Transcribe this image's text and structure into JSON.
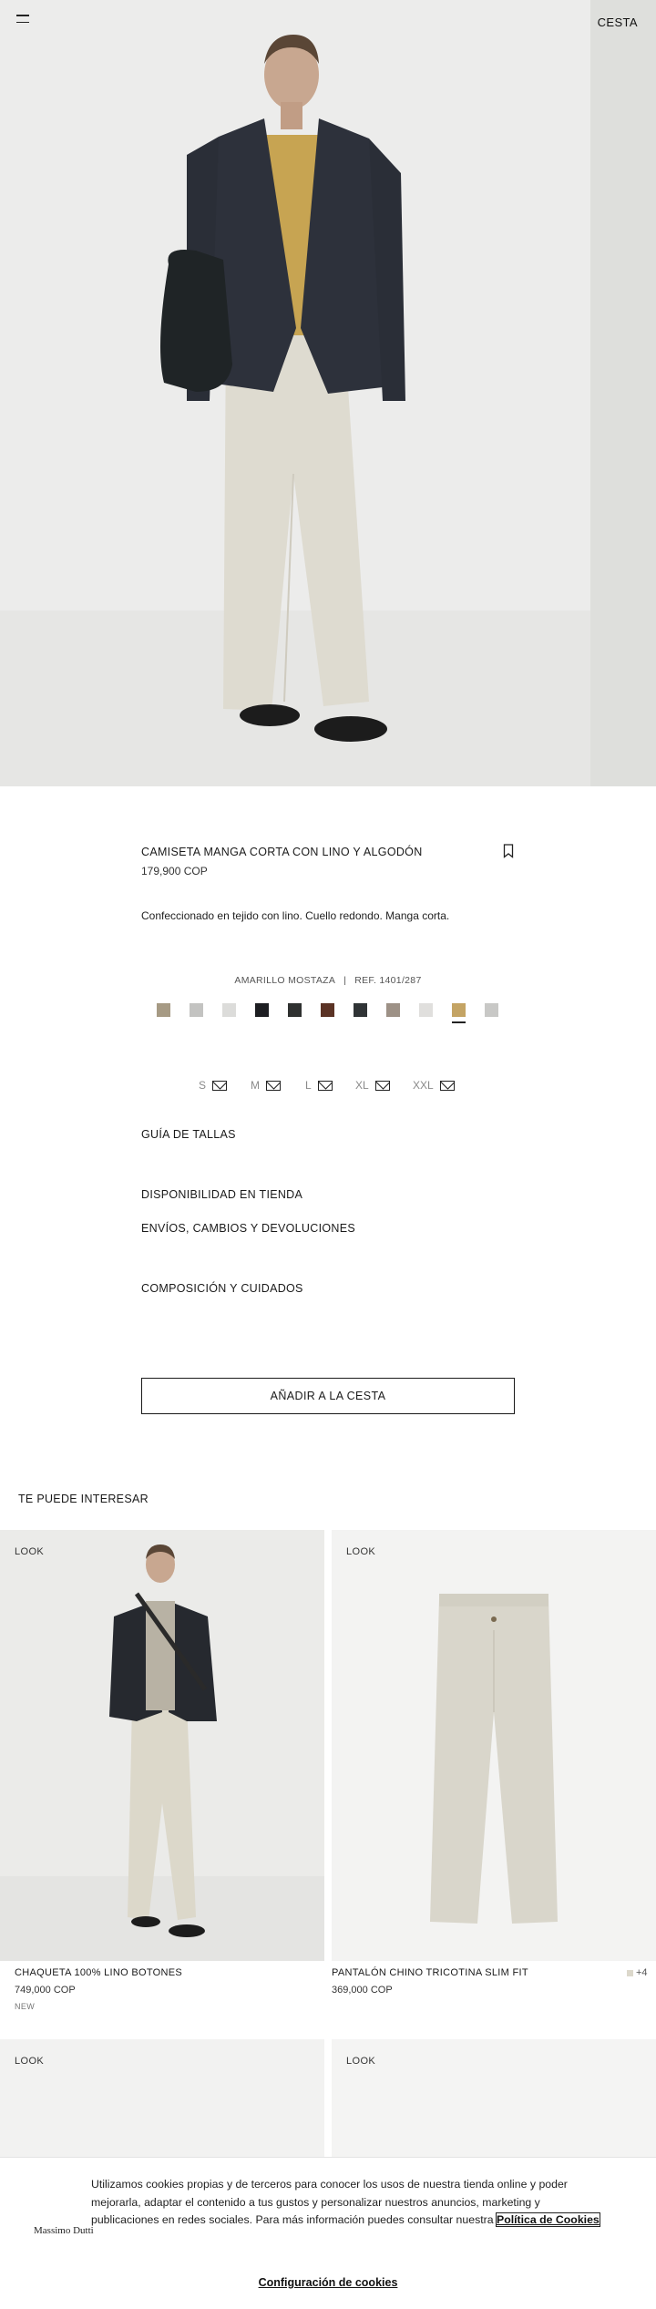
{
  "header": {
    "cart_label": "CESTA"
  },
  "product": {
    "title": "CAMISETA MANGA CORTA CON LINO Y ALGODÓN",
    "price": "179,900 COP",
    "description": "Confeccionado en tejido con lino. Cuello redondo. Manga corta.",
    "color_name": "AMARILLO MOSTAZA",
    "separator": "|",
    "reference": "REF. 1401/287",
    "swatches": [
      {
        "color": "#a69a84"
      },
      {
        "color": "#c3c3c1"
      },
      {
        "color": "#dcdcda"
      },
      {
        "color": "#1d1e22"
      },
      {
        "color": "#2f3130"
      },
      {
        "color": "#5b3325"
      },
      {
        "color": "#303436"
      },
      {
        "color": "#9d9186"
      },
      {
        "color": "#e0dfdd"
      },
      {
        "color": "#c4a464",
        "selected": true
      },
      {
        "color": "#c8c8c6"
      }
    ],
    "sizes": [
      "S",
      "M",
      "L",
      "XL",
      "XXL"
    ],
    "size_guide": "GUÍA DE TALLAS",
    "store_availability": "DISPONIBILIDAD EN TIENDA",
    "shipping": "ENVÍOS, CAMBIOS Y DEVOLUCIONES",
    "composition": "COMPOSICIÓN Y CUIDADOS",
    "add_to_cart": "AÑADIR A LA CESTA"
  },
  "recommendations": {
    "title": "TE PUEDE INTERESAR",
    "items": [
      {
        "look": "LOOK",
        "name": "CHAQUETA 100% LINO BOTONES",
        "price": "749,000 COP",
        "tag": "NEW"
      },
      {
        "look": "LOOK",
        "name": "PANTALÓN CHINO TRICOTINA SLIM FIT",
        "price": "369,000 COP",
        "more_colors": "+4"
      },
      {
        "look": "LOOK"
      },
      {
        "look": "LOOK"
      }
    ]
  },
  "cookie_banner": {
    "logo": "Massimo Dutti",
    "text": "Utilizamos cookies propias y de terceros para conocer los usos de nuestra tienda online y poder mejorarla, adaptar el contenido a tus gustos y personalizar nuestros anuncios, marketing y publicaciones en redes sociales. Para más información puedes consultar nuestra",
    "policy_link": "Política de Cookies",
    "settings_link": "Configuración de cookies"
  }
}
